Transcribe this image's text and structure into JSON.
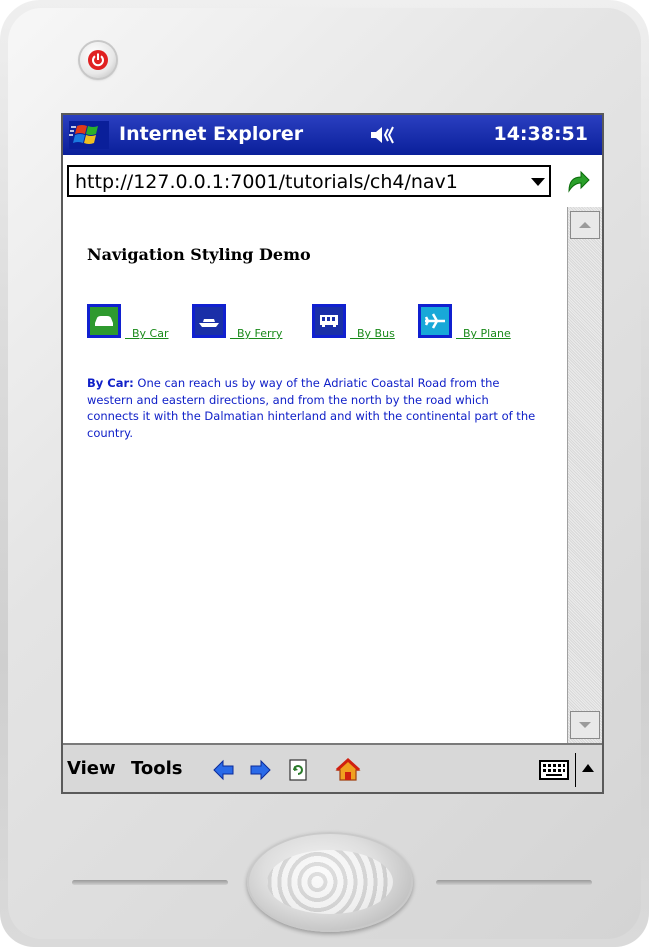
{
  "window": {
    "app_title": "Internet Explorer",
    "clock": "14:38:51"
  },
  "address": {
    "url": "http://127.0.0.1:7001/tutorials/ch4/nav1"
  },
  "page": {
    "title": "Navigation Styling Demo",
    "nav_links": [
      {
        "label": "By Car",
        "icon": "car-icon",
        "color": "#2e9a2e"
      },
      {
        "label": "By Ferry",
        "icon": "ferry-icon",
        "color": "#1a2fa8"
      },
      {
        "label": "By Bus",
        "icon": "bus-icon",
        "color": "#1a2fa8"
      },
      {
        "label": "By Plane",
        "icon": "plane-icon",
        "color": "#18a8d8"
      }
    ],
    "description_label": "By Car:",
    "description_text": " One can reach us by way of the Adriatic Coastal Road from the western and eastern directions, and from the north by the road which connects it with the Dalmatian hinterland and with the continental part of the country."
  },
  "toolbar": {
    "view_label": "View",
    "tools_label": "Tools"
  },
  "colors": {
    "titlebar": "#0a1f9a",
    "link_green": "#1a8a1a",
    "desc_blue": "#1020c8",
    "link_border": "#1020d0"
  }
}
